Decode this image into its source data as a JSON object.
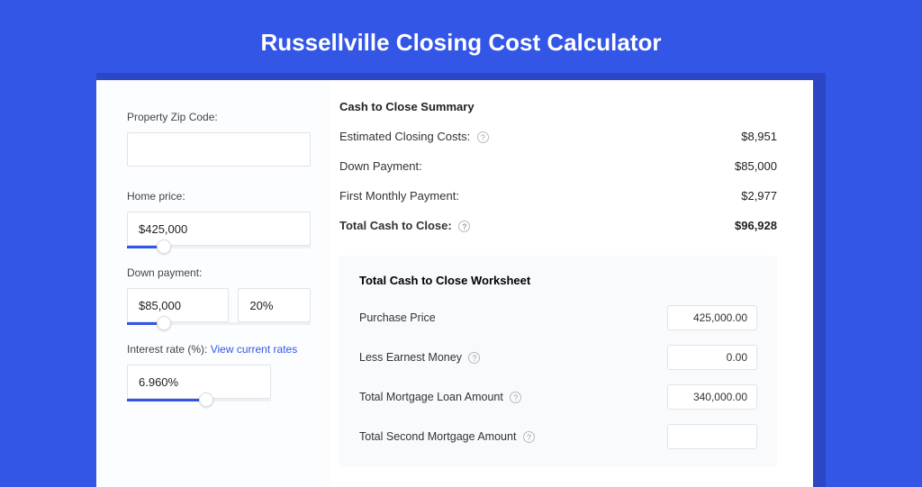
{
  "header": {
    "title": "Russellville Closing Cost Calculator"
  },
  "inputs": {
    "zip_label": "Property Zip Code:",
    "zip_value": "",
    "home_price_label": "Home price:",
    "home_price_value": "$425,000",
    "home_price_slider_pct": 20,
    "down_payment_label": "Down payment:",
    "down_payment_value": "$85,000",
    "down_payment_pct_value": "20%",
    "down_payment_slider_pct": 20,
    "interest_label": "Interest rate (%):",
    "interest_link": "View current rates",
    "interest_value": "6.960%",
    "interest_slider_pct": 55
  },
  "summary": {
    "heading": "Cash to Close Summary",
    "rows": [
      {
        "label": "Estimated Closing Costs:",
        "help": true,
        "value": "$8,951"
      },
      {
        "label": "Down Payment:",
        "help": false,
        "value": "$85,000"
      },
      {
        "label": "First Monthly Payment:",
        "help": false,
        "value": "$2,977"
      }
    ],
    "total_label": "Total Cash to Close:",
    "total_help": true,
    "total_value": "$96,928"
  },
  "worksheet": {
    "heading": "Total Cash to Close Worksheet",
    "rows": [
      {
        "label": "Purchase Price",
        "help": false,
        "value": "425,000.00"
      },
      {
        "label": "Less Earnest Money",
        "help": true,
        "value": "0.00"
      },
      {
        "label": "Total Mortgage Loan Amount",
        "help": true,
        "value": "340,000.00"
      },
      {
        "label": "Total Second Mortgage Amount",
        "help": true,
        "value": ""
      }
    ]
  }
}
